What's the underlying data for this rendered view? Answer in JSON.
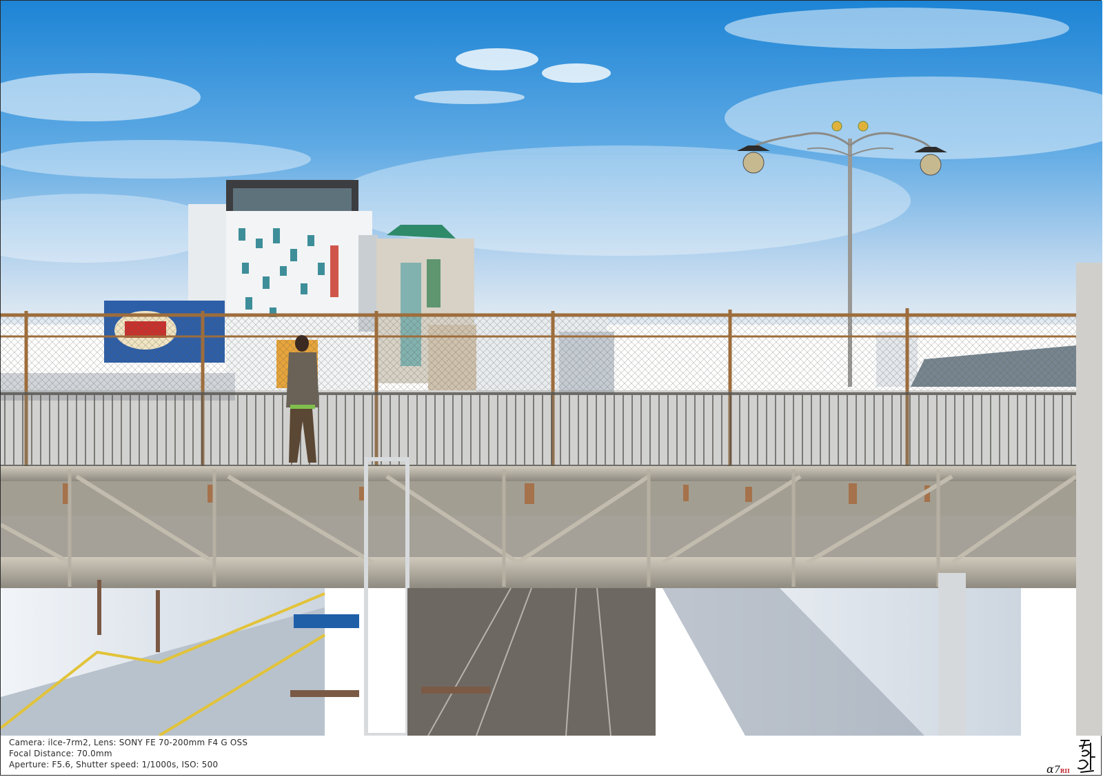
{
  "caption": {
    "line1": "Camera: ilce-7rm2, Lens: SONY FE 70-200mm F4 G OSS",
    "line2": "Focal Distance: 70.0mm",
    "line3": "Aperture: F5.6, Shutter speed: 1/1000s, ISO: 500"
  },
  "logo": {
    "alpha": "α",
    "model": "7",
    "suffix": "RII"
  },
  "colors": {
    "sky_top": "#1f86d6",
    "sky_mid": "#6fb1e6",
    "sky_low": "#dfe9f2",
    "rust": "#a8783f",
    "steel": "#b9b3a6",
    "track": "#6e6862",
    "canopy": "#e9edf2"
  }
}
